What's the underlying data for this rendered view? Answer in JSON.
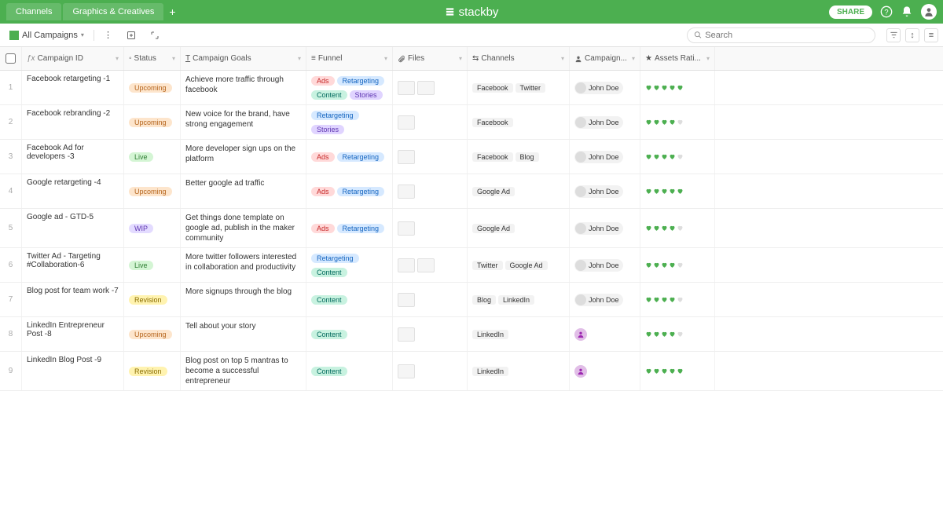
{
  "brand": "stackby",
  "topbar": {
    "tabs": [
      "Channels",
      "Graphics & Creatives"
    ],
    "share": "SHARE"
  },
  "viewbar": {
    "view_name": "All Campaigns",
    "search_placeholder": "Search"
  },
  "columns": {
    "num": "#",
    "name": "Campaign ID",
    "status": "Status",
    "goals": "Campaign Goals",
    "funnel": "Funnel",
    "files": "Files",
    "channels": "Channels",
    "campaign2": "Campaign...",
    "assets": "Assets Rati..."
  },
  "statusStyles": {
    "Upcoming": "pill-upcoming",
    "Live": "pill-live",
    "WIP": "pill-wip",
    "Revision": "pill-revision"
  },
  "funnelStyles": {
    "Ads": "pill-ads",
    "Retargeting": "pill-retarget",
    "Content": "pill-content",
    "Stories": "pill-stories"
  },
  "rows": [
    {
      "num": "1",
      "name": "Facebook retargeting -1",
      "status": "Upcoming",
      "goals": "Achieve more traffic through facebook",
      "funnel": [
        "Ads",
        "Retargeting",
        "Content",
        "Stories"
      ],
      "files": 2,
      "channels": [
        "Facebook",
        "Twitter"
      ],
      "owner": "John Doe",
      "rating": 5
    },
    {
      "num": "2",
      "name": "Facebook rebranding -2",
      "status": "Upcoming",
      "goals": "New voice for the brand, have strong engagement",
      "funnel": [
        "Retargeting",
        "Stories"
      ],
      "files": 1,
      "channels": [
        "Facebook"
      ],
      "owner": "John Doe",
      "rating": 4
    },
    {
      "num": "3",
      "name": "Facebook Ad for developers -3",
      "status": "Live",
      "goals": "More developer sign ups on the platform",
      "funnel": [
        "Ads",
        "Retargeting"
      ],
      "files": 1,
      "channels": [
        "Facebook",
        "Blog"
      ],
      "owner": "John Doe",
      "rating": 4
    },
    {
      "num": "4",
      "name": "Google retargeting -4",
      "status": "Upcoming",
      "goals": "Better google ad traffic",
      "funnel": [
        "Ads",
        "Retargeting"
      ],
      "files": 1,
      "channels": [
        "Google Ad"
      ],
      "owner": "John Doe",
      "rating": 5
    },
    {
      "num": "5",
      "name": "Google ad - GTD-5",
      "status": "WIP",
      "goals": "Get things done template on google ad, publish in the maker community",
      "funnel": [
        "Ads",
        "Retargeting"
      ],
      "files": 1,
      "channels": [
        "Google Ad"
      ],
      "owner": "John Doe",
      "rating": 4
    },
    {
      "num": "6",
      "name": "Twitter Ad - Targeting #Collaboration-6",
      "status": "Live",
      "goals": "More twitter followers interested in collaboration and productivity",
      "funnel": [
        "Retargeting",
        "Content"
      ],
      "files": 2,
      "channels": [
        "Twitter",
        "Google Ad"
      ],
      "owner": "John Doe",
      "rating": 4
    },
    {
      "num": "7",
      "name": "Blog post for team work -7",
      "status": "Revision",
      "goals": "More signups through the blog",
      "funnel": [
        "Content"
      ],
      "files": 1,
      "channels": [
        "Blog",
        "LinkedIn"
      ],
      "owner": "John Doe",
      "rating": 4
    },
    {
      "num": "8",
      "name": "LinkedIn Entrepreneur Post -8",
      "status": "Upcoming",
      "goals": "Tell about your story",
      "funnel": [
        "Content"
      ],
      "files": 1,
      "channels": [
        "LinkedIn"
      ],
      "owner_anon": true,
      "rating": 4
    },
    {
      "num": "9",
      "name": "LinkedIn Blog Post -9",
      "status": "Revision",
      "goals": "Blog post on top 5 mantras to become a successful entrepreneur",
      "funnel": [
        "Content"
      ],
      "files": 1,
      "channels": [
        "LinkedIn"
      ],
      "owner_anon": true,
      "rating": 5
    }
  ]
}
